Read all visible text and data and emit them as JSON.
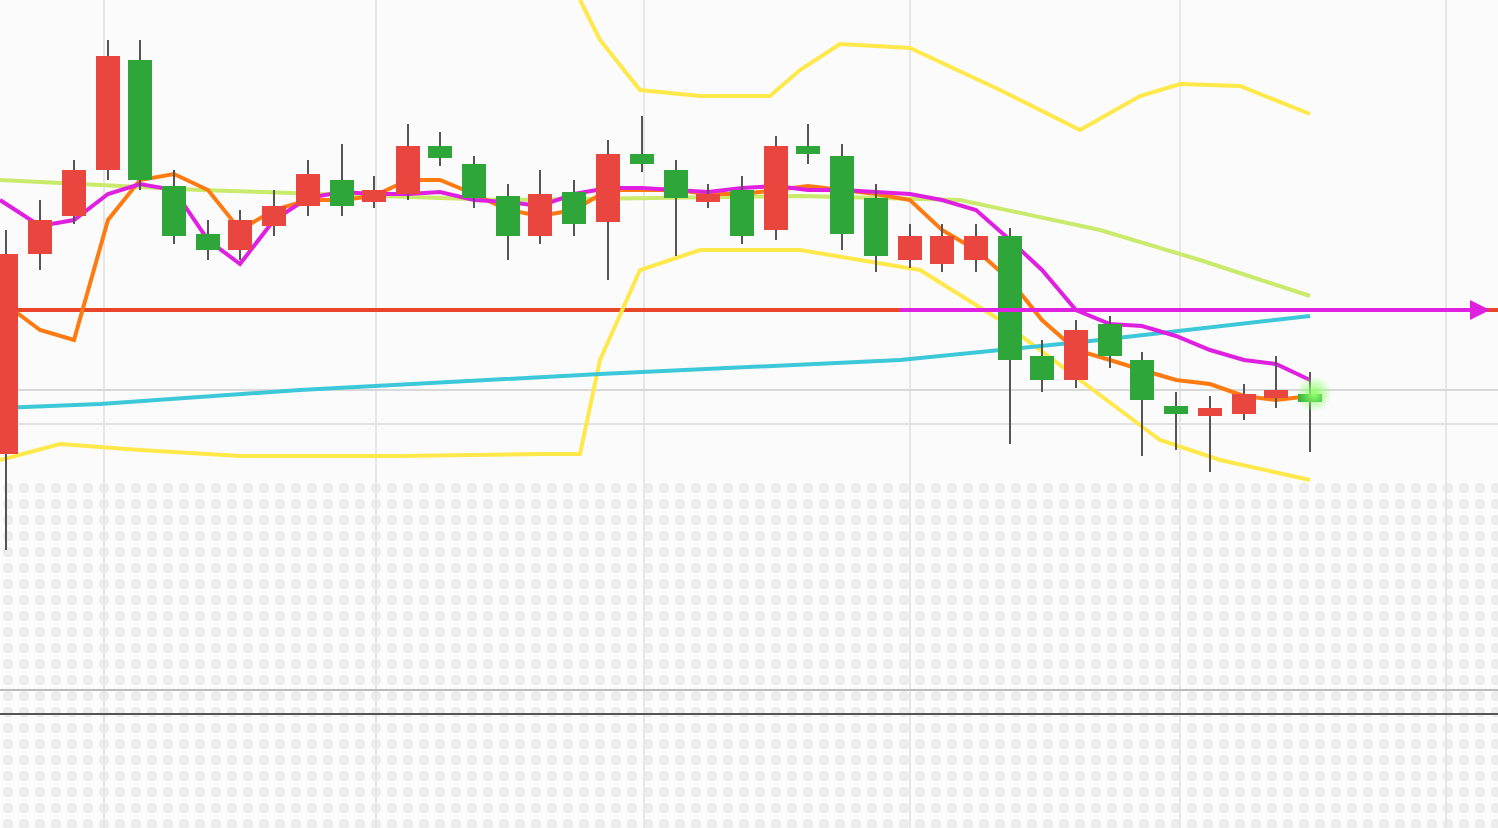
{
  "candles": [
    {
      "color": "#e8463f"
    },
    {
      "color": "#e8463f"
    },
    {
      "color": "#e8463f"
    },
    {
      "color": "#e8463f"
    },
    {
      "color": "#2ea63a"
    },
    {
      "color": "#2ea63a"
    },
    {
      "color": "#2ea63a"
    },
    {
      "color": "#e8463f"
    },
    {
      "color": "#e8463f"
    },
    {
      "color": "#e8463f"
    },
    {
      "color": "#2ea63a"
    },
    {
      "color": "#e8463f"
    },
    {
      "color": "#e8463f"
    },
    {
      "color": "#2ea63a"
    },
    {
      "color": "#2ea63a"
    },
    {
      "color": "#2ea63a"
    },
    {
      "color": "#e8463f"
    },
    {
      "color": "#2ea63a"
    },
    {
      "color": "#e8463f"
    },
    {
      "color": "#2ea63a"
    },
    {
      "color": "#2ea63a"
    },
    {
      "color": "#e8463f"
    },
    {
      "color": "#2ea63a"
    },
    {
      "color": "#e8463f"
    },
    {
      "color": "#2ea63a"
    },
    {
      "color": "#2ea63a"
    },
    {
      "color": "#2ea63a"
    },
    {
      "color": "#e8463f"
    },
    {
      "color": "#e8463f"
    },
    {
      "color": "#e8463f"
    },
    {
      "color": "#2ea63a"
    },
    {
      "color": "#2ea63a"
    },
    {
      "color": "#e8463f"
    },
    {
      "color": "#2ea63a"
    },
    {
      "color": "#2ea63a"
    },
    {
      "color": "#2ea63a"
    },
    {
      "color": "#e8463f"
    },
    {
      "color": "#e8463f"
    },
    {
      "color": "#e8463f"
    },
    {
      "color": "#2ea63a"
    }
  ]
}
